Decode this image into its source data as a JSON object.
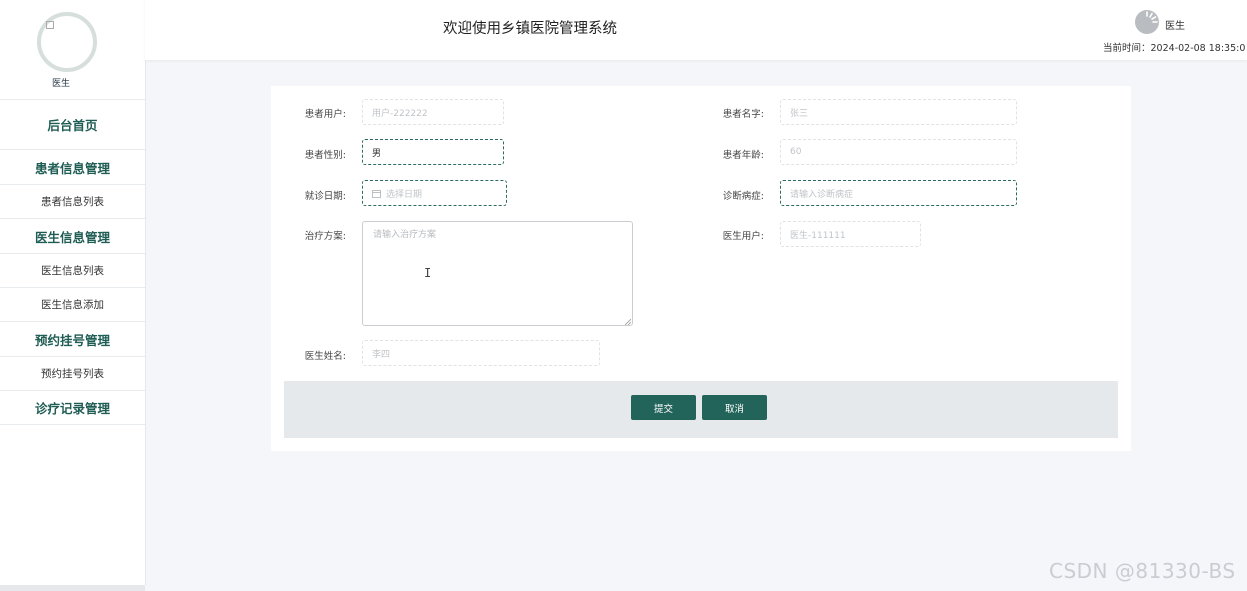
{
  "sidebar": {
    "avatar_alt": "",
    "role": "医生",
    "home": "后台首页",
    "groups": {
      "patient": "患者信息管理",
      "patient_list": "患者信息列表",
      "doctor": "医生信息管理",
      "doctor_list": "医生信息列表",
      "doctor_add": "医生信息添加",
      "booking": "预约挂号管理",
      "booking_list": "预约挂号列表",
      "records": "诊疗记录管理"
    }
  },
  "header": {
    "title": "欢迎使用乡镇医院管理系统",
    "user": "医生",
    "time_label": "当前时间：",
    "time_value": "2024-02-08 18:35:0"
  },
  "form": {
    "patient_user": {
      "label": "患者用户:",
      "placeholder": "用户-222222"
    },
    "patient_name": {
      "label": "患者名字:",
      "placeholder": "张三"
    },
    "patient_gender": {
      "label": "患者性别:",
      "value": "男"
    },
    "patient_age": {
      "label": "患者年龄:",
      "placeholder": "60"
    },
    "visit_date": {
      "label": "就诊日期:",
      "placeholder": "选择日期"
    },
    "diagnosis": {
      "label": "诊断病症:",
      "placeholder": "请输入诊断病症"
    },
    "treatment": {
      "label": "治疗方案:",
      "placeholder": "请输入治疗方案"
    },
    "doctor_user": {
      "label": "医生用户:",
      "placeholder": "医生-111111"
    },
    "doctor_name": {
      "label": "医生姓名:",
      "placeholder": "李四"
    },
    "submit": "提交",
    "cancel": "取消"
  },
  "watermark": "CSDN @81330-BS",
  "colors": {
    "accent": "#22635a",
    "menu_text": "#1f5d54"
  }
}
